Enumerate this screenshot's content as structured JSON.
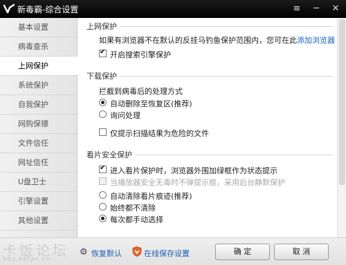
{
  "window": {
    "title": "新毒霸-综合设置",
    "menu_glyph": "≡",
    "min_glyph": "─",
    "close_glyph": "✕"
  },
  "sidebar": {
    "items": [
      {
        "label": "基本设置",
        "active": false
      },
      {
        "label": "病毒查杀",
        "active": false
      },
      {
        "label": "上网保护",
        "active": true
      },
      {
        "label": "系统保护",
        "active": false
      },
      {
        "label": "自我保护",
        "active": false
      },
      {
        "label": "网购保镖",
        "active": false
      },
      {
        "label": "文件信任",
        "active": false
      },
      {
        "label": "网址信任",
        "active": false
      },
      {
        "label": "U盘卫士",
        "active": false
      },
      {
        "label": "引擎设置",
        "active": false
      },
      {
        "label": "其他设置",
        "active": false
      }
    ]
  },
  "sections": {
    "web_protect": {
      "title": "上网保护",
      "desc": "如果有浏览器不在默认的反挂马钓鱼保护范围内，您可在此",
      "add_browser_link": "添加浏览器",
      "search_engine_protect": {
        "label": "开启搜索引擎保护",
        "checked": true
      }
    },
    "download_protect": {
      "title": "下载保护",
      "desc": "拦截到病毒后的处理方式",
      "options": [
        {
          "label": "自动删除至恢复区(推荐)",
          "checked": true
        },
        {
          "label": "询问处理",
          "checked": false
        }
      ],
      "only_dangerous": {
        "label": "仅提示扫描结果为危险的文件",
        "checked": false
      }
    },
    "video_protect": {
      "title": "看片安全保护",
      "enter_mode": {
        "label": "进入看片保护时，浏览器外围加绿框作为状态提示",
        "checked": true
      },
      "disabled_option": {
        "label": "当播放器安全无毒时不弹提示框，采用后台静默保护",
        "checked": false
      },
      "options": [
        {
          "label": "自动清除看片痕迹(推荐)",
          "checked": false
        },
        {
          "label": "始终都不清除",
          "checked": false
        },
        {
          "label": "每次都手动选择",
          "checked": true
        }
      ]
    }
  },
  "footer": {
    "watermark": "卡饭论坛",
    "watermark_url": "bbs.kafan.cn",
    "restore_default": "恢复默认",
    "online_save": "在线保存设置",
    "ok_label": "确  定",
    "cancel_label": "取  消"
  }
}
